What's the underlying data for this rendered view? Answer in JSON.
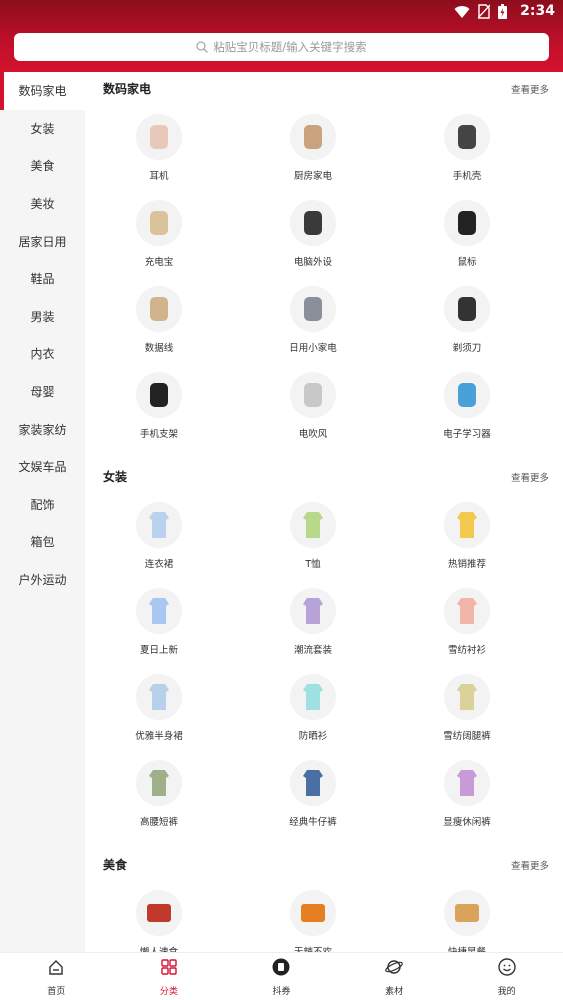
{
  "status": {
    "time": "2:34",
    "icons": [
      "wifi-icon",
      "no-sim-icon",
      "battery-icon"
    ]
  },
  "search": {
    "placeholder": "粘贴宝贝标题/输入关键字搜索",
    "icon": "search-icon"
  },
  "sidebar": {
    "active_index": 0,
    "items": [
      "数码家电",
      "女装",
      "美食",
      "美妆",
      "居家日用",
      "鞋品",
      "男装",
      "内衣",
      "母婴",
      "家装家纺",
      "文娱车品",
      "配饰",
      "箱包",
      "户外运动"
    ]
  },
  "sections": [
    {
      "title": "数码家电",
      "more": "查看更多",
      "items": [
        "耳机",
        "厨房家电",
        "手机壳",
        "充电宝",
        "电脑外设",
        "鼠标",
        "数据线",
        "日用小家电",
        "剃须刀",
        "手机支架",
        "电吹风",
        "电子学习器"
      ]
    },
    {
      "title": "女装",
      "more": "查看更多",
      "items": [
        "连衣裙",
        "T恤",
        "热销推荐",
        "夏日上新",
        "潮流套装",
        "雪纺衬衫",
        "优雅半身裙",
        "防晒衫",
        "雪纺阔腿裤",
        "高腰短裤",
        "经典牛仔裤",
        "显瘦休闲裤"
      ]
    },
    {
      "title": "美食",
      "more": "查看更多",
      "items": [
        "懒人速食",
        "无辣不欢",
        "快捷早餐"
      ]
    }
  ],
  "tabbar": {
    "active_index": 1,
    "items": [
      {
        "label": "首页",
        "icon": "home-icon"
      },
      {
        "label": "分类",
        "icon": "category-icon"
      },
      {
        "label": "抖券",
        "icon": "coupon-icon"
      },
      {
        "label": "素材",
        "icon": "planet-icon"
      },
      {
        "label": "我的",
        "icon": "profile-icon"
      }
    ]
  },
  "colors": {
    "brand": "#d3122f",
    "header_dark": "#8c0d1c",
    "sidebar_bg": "#f5f5f5"
  }
}
